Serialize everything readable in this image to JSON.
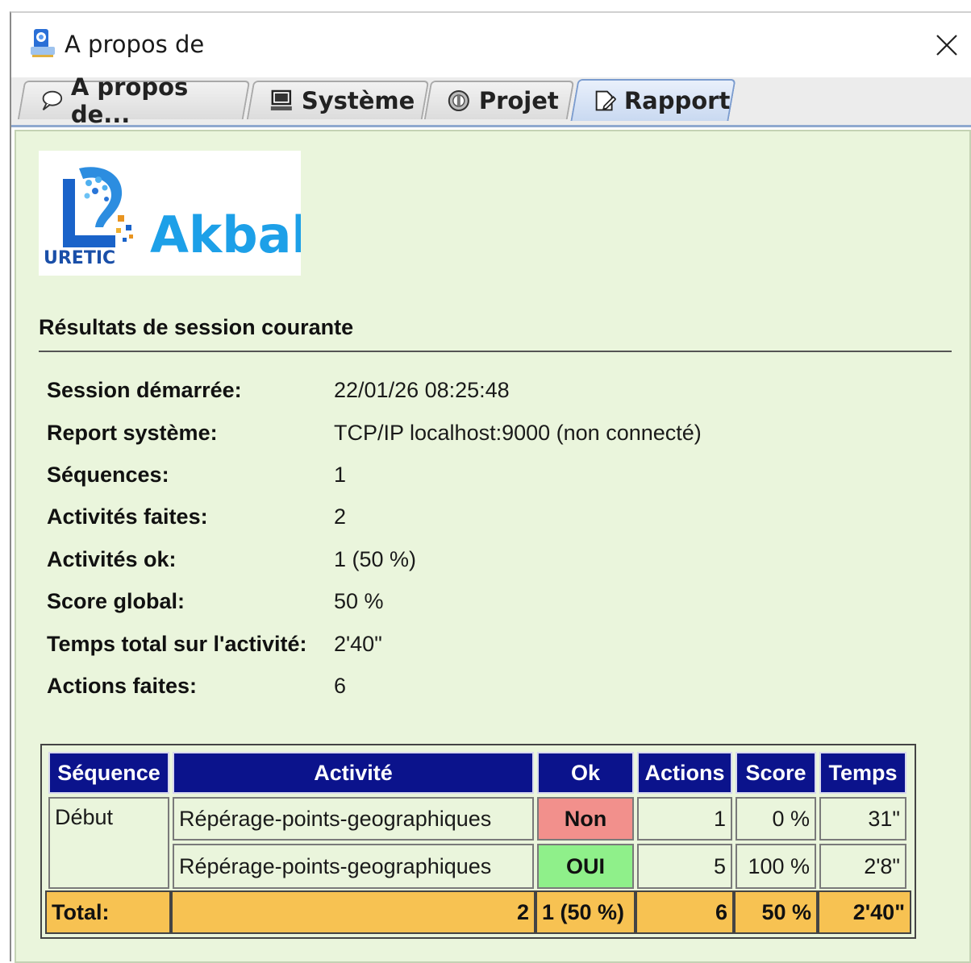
{
  "window": {
    "title": "A propos de"
  },
  "tabs": [
    {
      "label": "A propos de...",
      "icon": "speech-bubble-icon"
    },
    {
      "label": "Système",
      "icon": "computer-icon"
    },
    {
      "label": "Projet",
      "icon": "project-icon"
    },
    {
      "label": "Rapport",
      "icon": "report-icon",
      "active": true
    }
  ],
  "logo": {
    "badge_text": "URETIC",
    "name": "Akbal"
  },
  "section": {
    "title": "Résultats de session courante"
  },
  "info": [
    {
      "label": "Session démarrée:",
      "value": "22/01/26 08:25:48"
    },
    {
      "label": "Report système:",
      "value": "TCP/IP localhost:9000 (non connecté)"
    },
    {
      "label": "Séquences:",
      "value": "1"
    },
    {
      "label": "Activités faites:",
      "value": "2"
    },
    {
      "label": "Activités ok:",
      "value": "1 (50 %)"
    },
    {
      "label": "Score global:",
      "value": "50 %"
    },
    {
      "label": "Temps total sur l'activité:",
      "value": "2'40\""
    },
    {
      "label": "Actions faites:",
      "value": "6"
    }
  ],
  "table": {
    "headers": [
      "Séquence",
      "Activité",
      "Ok",
      "Actions",
      "Score",
      "Temps"
    ],
    "rows": [
      {
        "sequence": "Début",
        "activity": "Répérage-points-geographiques",
        "ok": "Non",
        "actions": "1",
        "score": "0 %",
        "time": "31\""
      },
      {
        "sequence": "",
        "activity": "Répérage-points-geographiques",
        "ok": "OUI",
        "actions": "5",
        "score": "100 %",
        "time": "2'8\""
      }
    ],
    "total": {
      "label": "Total:",
      "activities": "2",
      "ok": "1 (50 %)",
      "actions": "6",
      "score": "50 %",
      "time": "2'40\""
    }
  },
  "colors": {
    "panel_bg": "#eaf5dc",
    "header_bg": "#0b138c",
    "total_bg": "#f7c252",
    "ok_no": "#f2908c",
    "ok_yes": "#8ff08a"
  }
}
